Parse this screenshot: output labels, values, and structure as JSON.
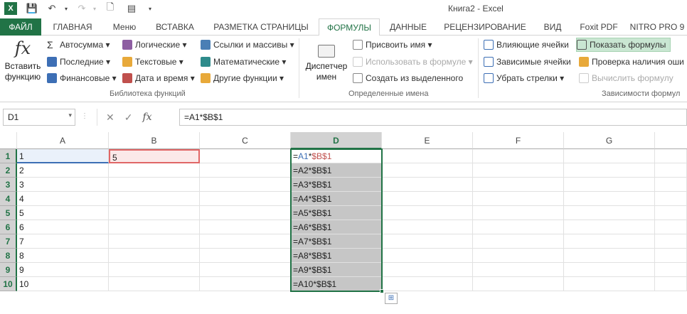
{
  "window": {
    "title": "Книга2 - Excel"
  },
  "tabs": [
    "ФАЙЛ",
    "ГЛАВНАЯ",
    "Меню",
    "ВСТАВКА",
    "РАЗМЕТКА СТРАНИЦЫ",
    "ФОРМУЛЫ",
    "ДАННЫЕ",
    "РЕЦЕНЗИРОВАНИЕ",
    "ВИД",
    "Foxit PDF",
    "NITRO PRO 9"
  ],
  "ribbon": {
    "insert_function_line1": "Вставить",
    "insert_function_line2": "функцию",
    "fx_glyph": "fx",
    "lib": {
      "autosum": "Автосумма",
      "recent": "Последние",
      "financial": "Финансовые",
      "logical": "Логические",
      "text": "Текстовые",
      "datetime": "Дата и время",
      "lookup": "Ссылки и массивы",
      "math": "Математические",
      "other": "Другие функции",
      "group_label": "Библиотека функций"
    },
    "names": {
      "manager_line1": "Диспетчер",
      "manager_line2": "имен",
      "define": "Присвоить имя",
      "use_in_formula": "Использовать в формуле",
      "create_from_sel": "Создать из выделенного",
      "group_label": "Определенные имена"
    },
    "audit": {
      "precedents": "Влияющие ячейки",
      "dependents": "Зависимые ячейки",
      "remove_arrows": "Убрать стрелки",
      "show_formulas": "Показать формулы",
      "error_check": "Проверка наличия оши",
      "evaluate": "Вычислить формулу",
      "group_label": "Зависимости формул"
    }
  },
  "formula_bar": {
    "name_box": "D1",
    "formula": "=A1*$B$1",
    "fx": "fx",
    "cancel": "✕",
    "enter": "✓"
  },
  "grid": {
    "columns": [
      "A",
      "B",
      "C",
      "D",
      "E",
      "F",
      "G"
    ],
    "rows": [
      "1",
      "2",
      "3",
      "4",
      "5",
      "6",
      "7",
      "8",
      "9",
      "10"
    ],
    "col_a": [
      "1",
      "2",
      "3",
      "4",
      "5",
      "6",
      "7",
      "8",
      "9",
      "10"
    ],
    "b1": "5",
    "d1_parts": [
      "=",
      "A1",
      "*",
      "$B$1"
    ],
    "col_d": [
      "=A2*$B$1",
      "=A3*$B$1",
      "=A4*$B$1",
      "=A5*$B$1",
      "=A6*$B$1",
      "=A7*$B$1",
      "=A8*$B$1",
      "=A9*$B$1",
      "=A10*$B$1"
    ]
  },
  "colors": {
    "excel_green": "#217346",
    "ref_blue": "#3d6fb5",
    "ref_red": "#c0504d"
  }
}
